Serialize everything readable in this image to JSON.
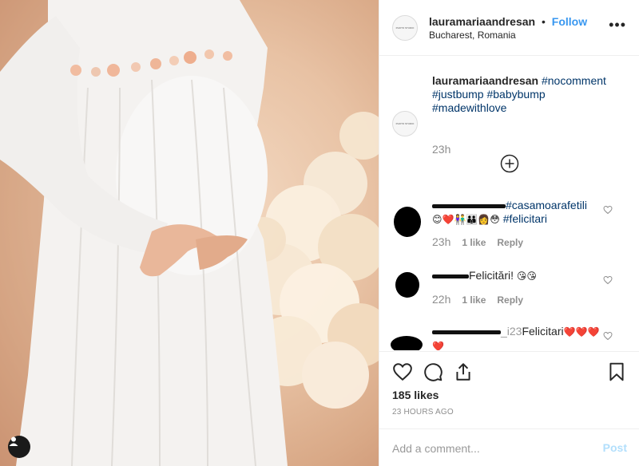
{
  "post": {
    "username": "lauramariaandresan",
    "separator": "•",
    "follow_label": "Follow",
    "location": "Bucharest, Romania",
    "more_label": "•••",
    "avatar_text": "PHOTO STUDIO"
  },
  "caption": {
    "username": "lauramariaandresan",
    "hashtags": [
      "#nocomment",
      "#justbump",
      "#babybump",
      "#madewithlove"
    ],
    "time": "23h"
  },
  "load_more_icon": "plus-circle-icon",
  "comments": [
    {
      "text_link": "#casamoarafetili",
      "emojis": "😊❤️👫👪👩😳",
      "text_tail": "#felicitari",
      "time": "23h",
      "likes": "1 like",
      "reply": "Reply"
    },
    {
      "text": "Felicitări!",
      "emojis": "😘😘",
      "time": "22h",
      "likes": "1 like",
      "reply": "Reply"
    },
    {
      "visible_fragment": "_i23",
      "text": "Felicitari",
      "emojis": "❤️❤️❤️",
      "emojis_line2": "❤️"
    }
  ],
  "actions": {
    "like_icon": "heart-icon",
    "comment_icon": "comment-icon",
    "share_icon": "share-icon",
    "save_icon": "bookmark-icon"
  },
  "likes": "185 likes",
  "posted_ago": "23 HOURS AGO",
  "add_comment": {
    "placeholder": "Add a comment...",
    "post_label": "Post"
  },
  "colors": {
    "link": "#3897f0",
    "hashtag": "#003569",
    "muted": "#8e8e8e",
    "post_disabled": "#b2dffc"
  }
}
